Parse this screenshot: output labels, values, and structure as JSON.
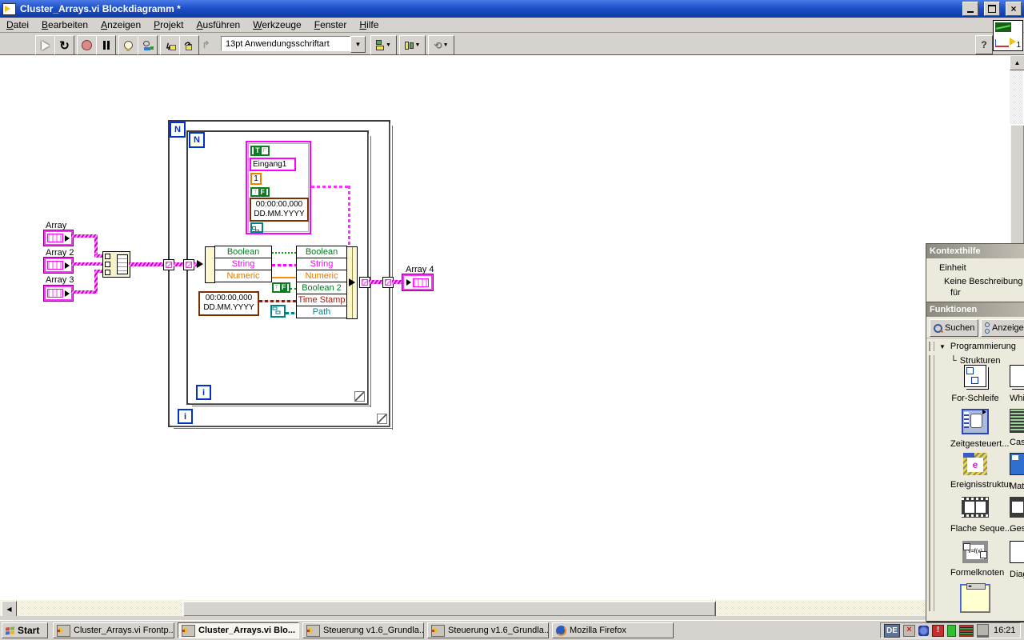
{
  "window": {
    "title": "Cluster_Arrays.vi Blockdiagramm *"
  },
  "menu": {
    "items": [
      "Datei",
      "Bearbeiten",
      "Anzeigen",
      "Projekt",
      "Ausführen",
      "Werkzeuge",
      "Fenster",
      "Hilfe"
    ]
  },
  "toolbar": {
    "font_selector": "13pt Anwendungsschriftart",
    "help": "?"
  },
  "diagram": {
    "outer_loop": {
      "count": "N",
      "iterator": "i"
    },
    "inner_loop": {
      "count": "N",
      "iterator": "i"
    },
    "controls": {
      "array1": "Array",
      "array2": "Array 2",
      "array3": "Array 3",
      "array4": "Array 4"
    },
    "cluster_constant": {
      "bool_true_big": "T",
      "bool_true_small": "F",
      "string": "Eingang1",
      "numeric": "1",
      "bool_false_big": "F",
      "bool_false_small": "T",
      "time_line1": "00:00:00,000",
      "time_line2": "DD.MM.YYYY"
    },
    "unbundle_rows": [
      "Boolean",
      "String",
      "Numeric"
    ],
    "bundle_rows": [
      "Boolean",
      "String",
      "Numeric",
      "Boolean 2",
      "Time Stamp",
      "Path"
    ],
    "time_constant": {
      "line1": "00:00:00,000",
      "line2": "DD.MM.YYYY"
    },
    "bool_constant": {
      "big": "F",
      "small": "T"
    }
  },
  "context_help": {
    "title": "Kontexthilfe",
    "lines": [
      "Einheit",
      "Keine Beschreibung",
      "für"
    ]
  },
  "palette": {
    "title": "Funktionen",
    "search_label": "Suchen",
    "view_label": "Anzeige",
    "expand_glyph": "▼",
    "tree_glyph": "└",
    "category": "Programmierung",
    "subcategory": "Strukturen",
    "col1": [
      "For-Schleife",
      "Zeitgesteuert...",
      "Ereignisstruktur",
      "Flache Seque...",
      "Formelknoten"
    ],
    "col2": [
      "While",
      "Case",
      "MathS",
      "Gesta",
      "Diagra"
    ],
    "formula_icon_text": "v=f(x)",
    "event_icon_text": "e"
  },
  "taskbar": {
    "start": "Start",
    "tasks": [
      "Cluster_Arrays.vi Frontp...",
      "Cluster_Arrays.vi Blo...",
      "Steuerung v1.6_Grundla...",
      "Steuerung v1.6_Grundla...",
      "Mozilla Firefox"
    ],
    "tray": {
      "lang": "DE",
      "time": "16:21"
    }
  },
  "colors": {
    "titlebar_blue": "#1e50c8",
    "array_pink": "#ff00ff",
    "boolean_green": "#007a1f",
    "numeric_orange": "#e07800",
    "timestamp_brown": "#9b1a0a",
    "path_teal": "#00828c"
  }
}
